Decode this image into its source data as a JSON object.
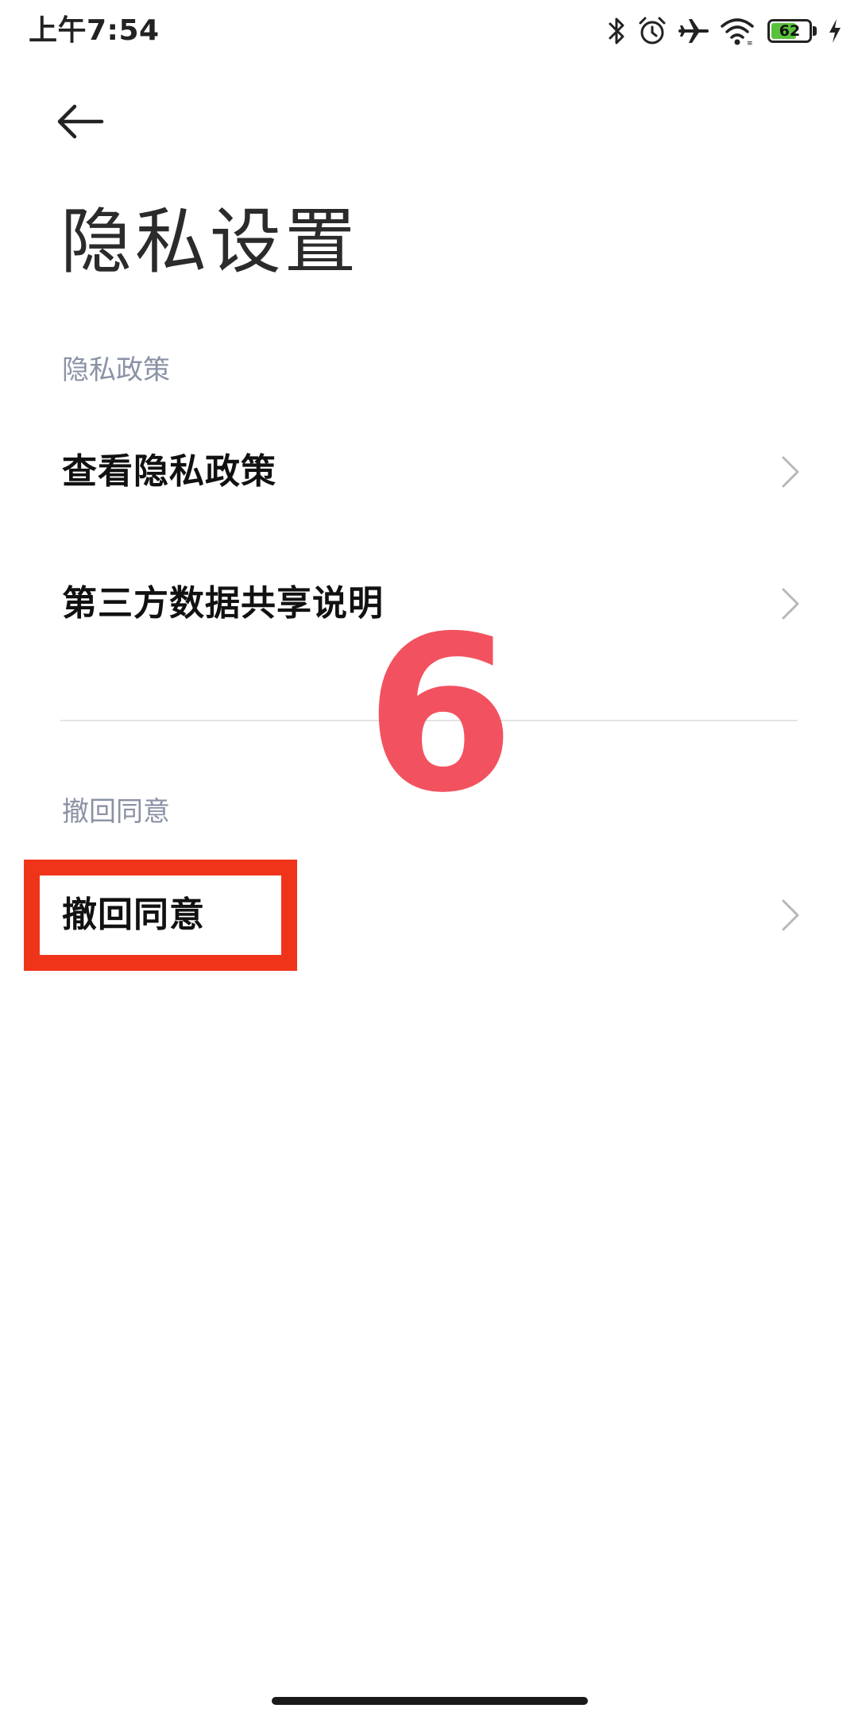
{
  "status_bar": {
    "time": "上午7:54",
    "battery_level": "62",
    "battery_fraction": 0.62,
    "icons": [
      "bluetooth-icon",
      "alarm-icon",
      "airplane-icon",
      "wifi-icon",
      "battery-icon",
      "charging-icon"
    ]
  },
  "header": {
    "back_icon": "arrow-left-icon",
    "title": "隐私设置"
  },
  "sections": [
    {
      "header": "隐私政策",
      "items": [
        {
          "label": "查看隐私政策",
          "icon": "chevron-right-icon"
        },
        {
          "label": "第三方数据共享说明",
          "icon": "chevron-right-icon"
        }
      ]
    },
    {
      "header": "撤回同意",
      "items": [
        {
          "label": "撤回同意",
          "icon": "chevron-right-icon"
        }
      ]
    }
  ],
  "overlay": {
    "step_number": "6",
    "step_color": "#f2525f",
    "highlight_color": "#f0341a"
  },
  "colors": {
    "section_header": "#8a92a5",
    "battery_fill": "#58c13b"
  }
}
